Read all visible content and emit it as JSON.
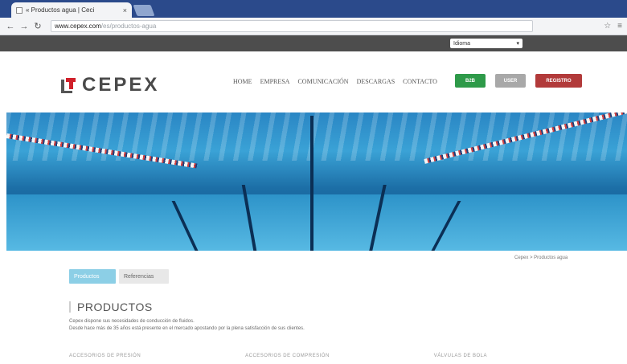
{
  "browser": {
    "tab_title": "« Productos agua | Ceci",
    "tab_close": "×",
    "url_host": "www.cepex.com",
    "url_path": "/es/productos-agua",
    "nav_icons": [
      "back-icon",
      "forward-icon",
      "reload-icon"
    ],
    "toolbar_icons": [
      "star-icon",
      "menu-icon"
    ]
  },
  "topbar": {
    "language": "Idioma"
  },
  "header": {
    "logo_text": "CEPEX",
    "nav": [
      "HOME",
      "EMPRESA",
      "COMUNICACIÓN",
      "DESCARGAS",
      "CONTACTO"
    ],
    "buttons": [
      {
        "label": "B2B",
        "color": "#2e9a49"
      },
      {
        "label": "USER",
        "color": "#a8a8a8"
      },
      {
        "label": "REGISTRO",
        "color": "#b23a3a"
      }
    ]
  },
  "hero": {
    "caption": "Cepex > Productos agua"
  },
  "content": {
    "tabs": [
      "Productos",
      "Referencias"
    ],
    "section_title": "PRODUCTOS",
    "description": [
      "Cepex dispone sus necesidades de conducción de fluidos.",
      "Desde hace más de 35 años está presente en el mercado apostando por la plena satisfacción de sus clientes."
    ],
    "categories": [
      "ACCESORIOS DE PRESIÓN",
      "ACCESORIOS DE COMPRESIÓN",
      "VÁLVULAS DE BOLA"
    ]
  }
}
